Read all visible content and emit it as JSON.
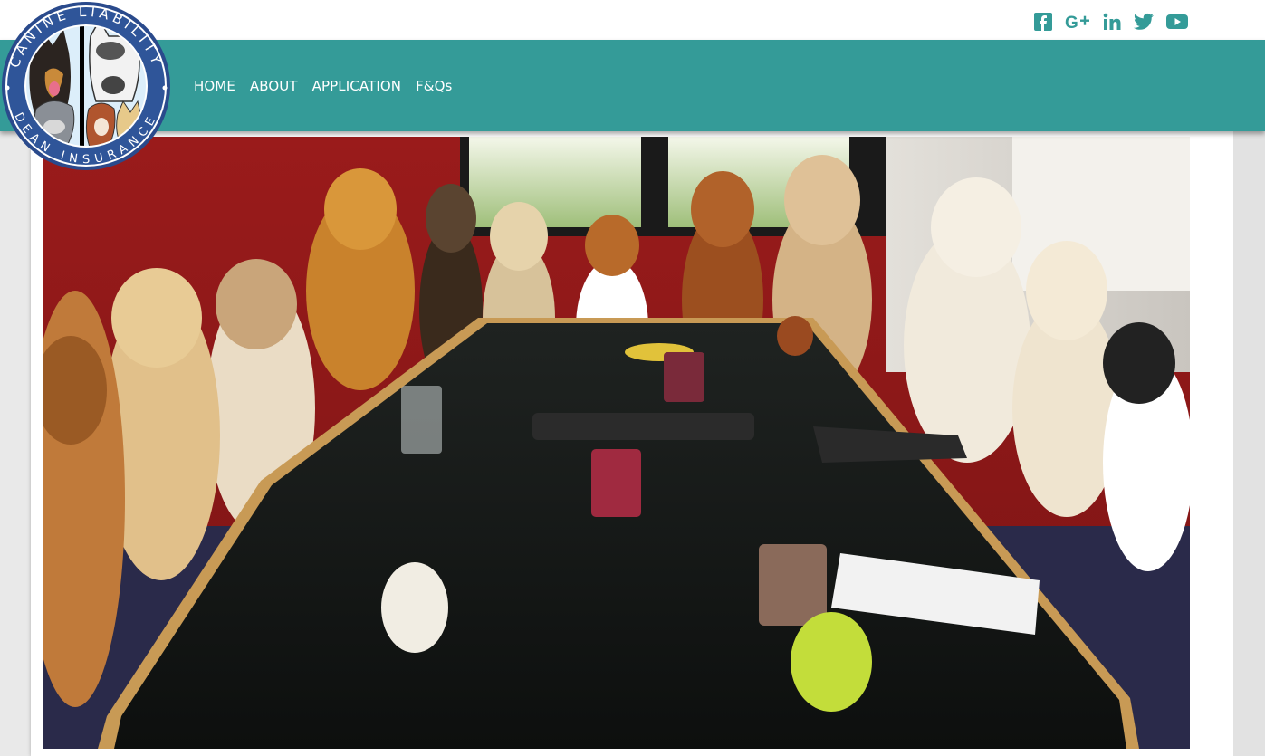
{
  "brand": {
    "logo_ring_text_top": "CANINE LIABILITY",
    "logo_ring_text_bottom": "DEAN INSURANCE"
  },
  "social": [
    {
      "icon": "facebook-icon",
      "glyph": "f"
    },
    {
      "icon": "google-plus-icon",
      "glyph": "G+"
    },
    {
      "icon": "linkedin-icon",
      "glyph": "in"
    },
    {
      "icon": "twitter-icon",
      "glyph": ""
    },
    {
      "icon": "youtube-icon",
      "glyph": ""
    }
  ],
  "nav": {
    "items": [
      {
        "label": "HOME"
      },
      {
        "label": "ABOUT"
      },
      {
        "label": "APPLICATION"
      },
      {
        "label": "F&Qs"
      }
    ]
  },
  "colors": {
    "accent": "#349b98",
    "social_icon": "#349b98",
    "background": "#e9e9e9"
  },
  "hero": {
    "image_subject": "dogs-around-conference-table"
  }
}
